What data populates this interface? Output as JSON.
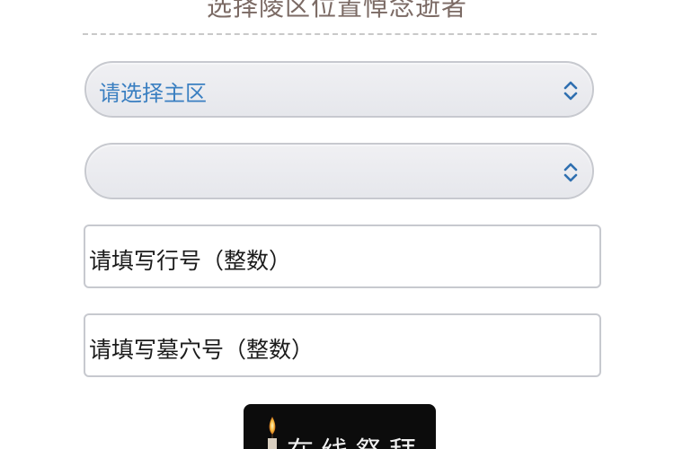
{
  "header": {
    "title": "选择陵区位置悼念逝者"
  },
  "form": {
    "main_area_select": {
      "placeholder": "请选择主区"
    },
    "sub_area_select": {
      "placeholder": ""
    },
    "row_input": {
      "placeholder": "请填写行号（整数）"
    },
    "grave_input": {
      "placeholder": "请填写墓穴号（整数）"
    }
  },
  "action": {
    "worship_label": "在线祭拜"
  },
  "icons": {
    "select_arrow": "chevron-up-down-icon",
    "candle": "candle-icon"
  },
  "colors": {
    "select_text": "#3a7fc1",
    "title_text": "#7b6a64",
    "button_bg": "#0c0c0c"
  }
}
